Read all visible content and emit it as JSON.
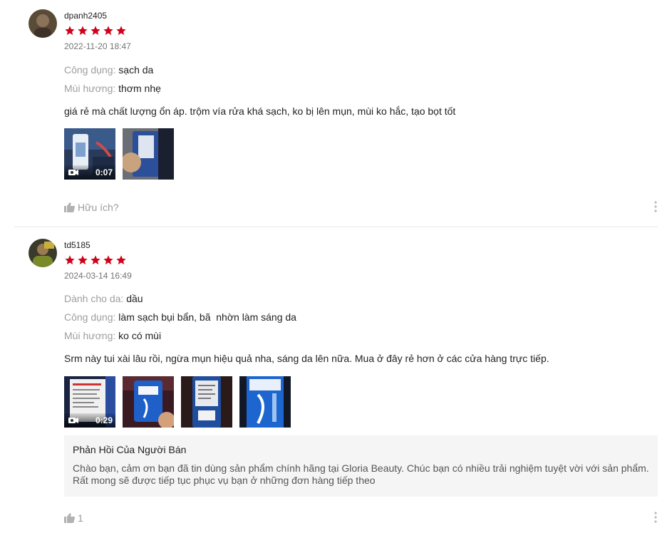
{
  "reviews": [
    {
      "username": "dpanh2405",
      "rating": 5,
      "date": "2022-11-20 18:47",
      "attributes": [
        {
          "key": "Công dụng:",
          "value": "sạch da"
        },
        {
          "key": "Mùi hương:",
          "value": "thơm nhẹ"
        }
      ],
      "text": "giá rẻ mà chất lượng ổn áp. trộm vía rửa khá sạch, ko bị lên mụn, mùi ko hắc, tạo bọt tốt",
      "media": [
        {
          "type": "video",
          "duration": "0:07"
        },
        {
          "type": "image"
        }
      ],
      "helpful_label": "Hữu ích?",
      "helpful_count": ""
    },
    {
      "username": "td5185",
      "rating": 5,
      "date": "2024-03-14 16:49",
      "attributes": [
        {
          "key": "Dành cho da:",
          "value": "dầu"
        },
        {
          "key": "Công dụng:",
          "value": "làm sạch bụi bẩn, bã  nhờn làm sáng da"
        },
        {
          "key": "Mùi hương:",
          "value": "ko có mùi"
        }
      ],
      "text": "Srm này tui xài lâu rồi, ngừa mụn hiệu quả nha, sáng da lên nữa. Mua ở đây rẻ hơn ở các cửa hàng trực tiếp.",
      "media": [
        {
          "type": "video",
          "duration": "0:29"
        },
        {
          "type": "image"
        },
        {
          "type": "image"
        },
        {
          "type": "image"
        }
      ],
      "seller_reply": {
        "title": "Phản Hồi Của Người Bán",
        "line1": "Chào bạn, cảm ơn bạn đã tin dùng sản phẩm chính hãng tại Gloria Beauty. Chúc bạn có nhiều trải nghiệm tuyệt vời với sản phẩm.",
        "line2": "Rất mong sẽ được tiếp tục phục vụ bạn ở những đơn hàng tiếp theo"
      },
      "helpful_label": "",
      "helpful_count": "1"
    }
  ],
  "colors": {
    "star": "#d0011b",
    "muted_key": "#9e9e9e",
    "date": "#757575",
    "reply_bg": "#f5f5f5"
  },
  "icons": {
    "star": "star-icon",
    "thumbs_up": "thumbs-up-icon",
    "more": "more-vertical-icon",
    "video": "video-camera-icon"
  }
}
